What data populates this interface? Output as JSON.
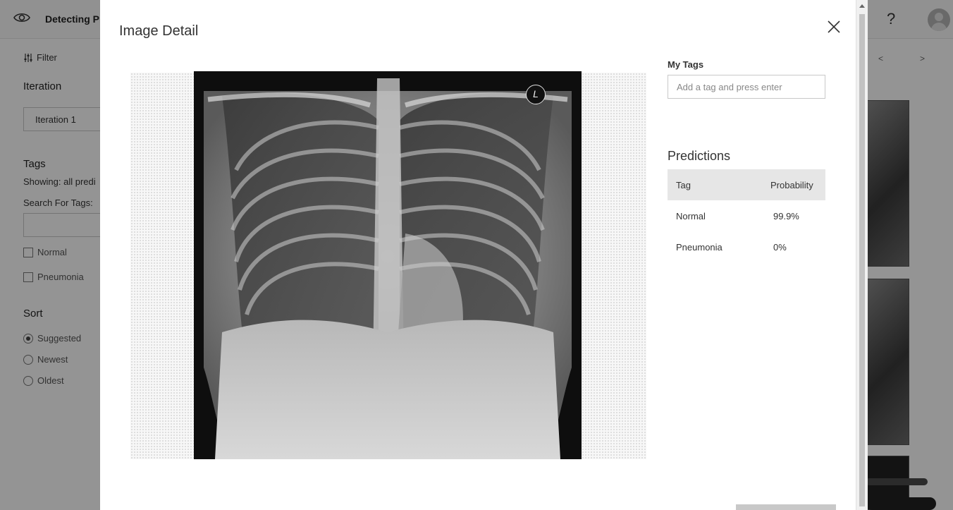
{
  "app": {
    "title": "Detecting Pn",
    "help_label": "?",
    "filter_label": "Filter",
    "iteration_heading": "Iteration",
    "iteration_value": "Iteration 1",
    "tags_heading": "Tags",
    "showing_text": "Showing: all predi",
    "search_tags_label": "Search For Tags:",
    "tag_filters": [
      "Normal",
      "Pneumonia"
    ],
    "sort_heading": "Sort",
    "sort_options": [
      "Suggested",
      "Newest",
      "Oldest"
    ],
    "sort_selected": "Suggested",
    "nav_prev": "<",
    "nav_next": ">"
  },
  "modal": {
    "title": "Image Detail",
    "image_marker": "L",
    "my_tags_label": "My Tags",
    "tag_input_placeholder": "Add a tag and press enter",
    "predictions_title": "Predictions",
    "predictions_columns": {
      "tag": "Tag",
      "probability": "Probability"
    },
    "predictions": [
      {
        "tag": "Normal",
        "probability": "99.9%"
      },
      {
        "tag": "Pneumonia",
        "probability": "0%"
      }
    ]
  }
}
